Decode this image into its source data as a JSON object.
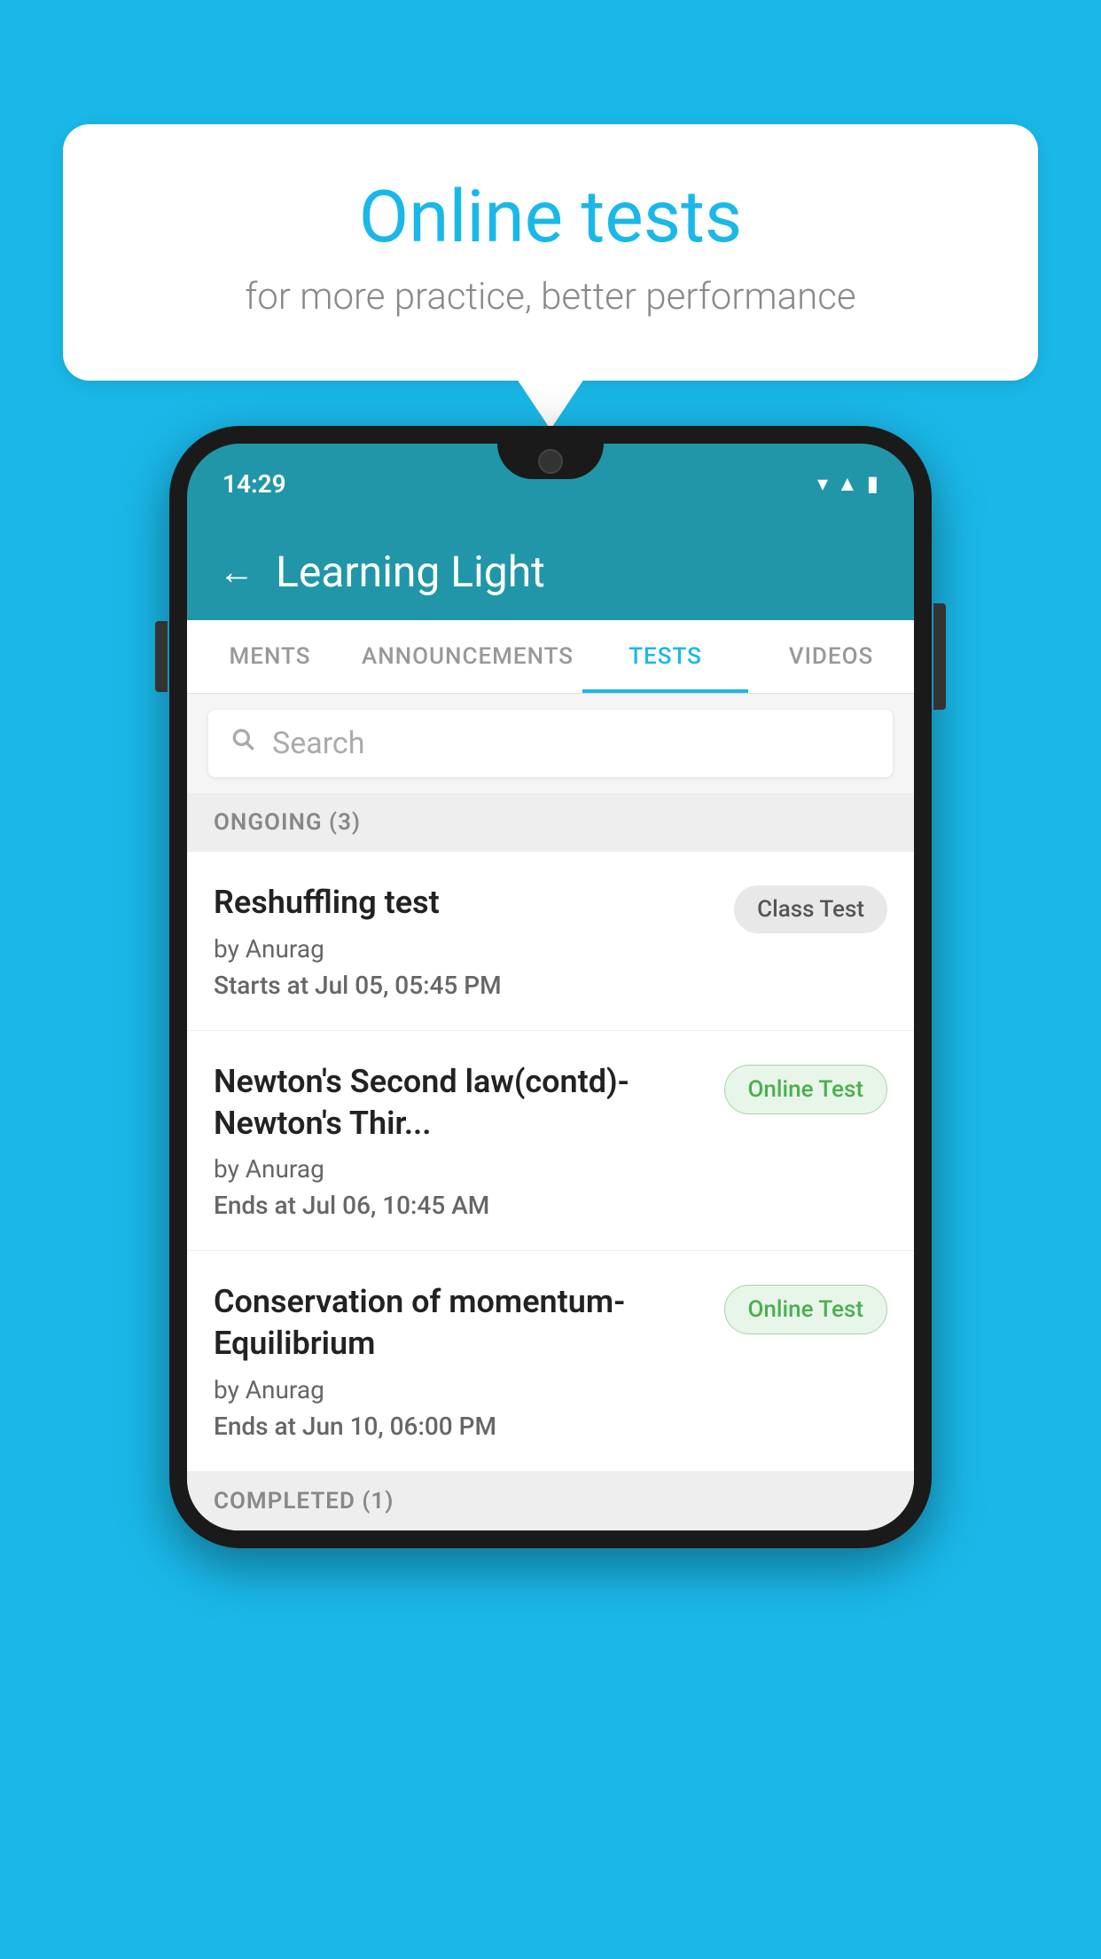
{
  "background_color": "#1ab8e8",
  "bubble": {
    "title": "Online tests",
    "subtitle": "for more practice, better performance"
  },
  "phone": {
    "status_time": "14:29",
    "header": {
      "title": "Learning Light",
      "back_label": "←"
    },
    "tabs": [
      {
        "label": "MENTS",
        "active": false
      },
      {
        "label": "ANNOUNCEMENTS",
        "active": false
      },
      {
        "label": "TESTS",
        "active": true
      },
      {
        "label": "VIDEOS",
        "active": false
      }
    ],
    "search": {
      "placeholder": "Search"
    },
    "section_ongoing": "ONGOING (3)",
    "tests": [
      {
        "title": "Reshuffling test",
        "author": "by Anurag",
        "time_label": "Starts at",
        "time_value": "Jul 05, 05:45 PM",
        "badge": "Class Test",
        "badge_type": "class"
      },
      {
        "title": "Newton's Second law(contd)-Newton's Thir...",
        "author": "by Anurag",
        "time_label": "Ends at",
        "time_value": "Jul 06, 10:45 AM",
        "badge": "Online Test",
        "badge_type": "online"
      },
      {
        "title": "Conservation of momentum-Equilibrium",
        "author": "by Anurag",
        "time_label": "Ends at",
        "time_value": "Jun 10, 06:00 PM",
        "badge": "Online Test",
        "badge_type": "online"
      }
    ],
    "section_completed": "COMPLETED (1)"
  }
}
